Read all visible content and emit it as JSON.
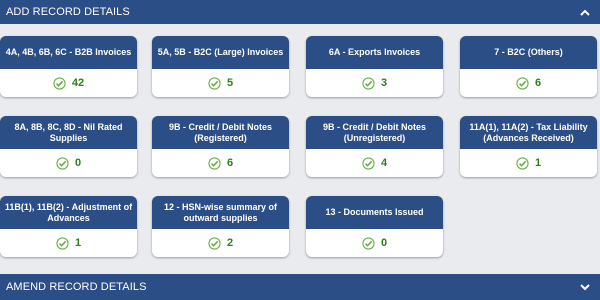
{
  "add_section": {
    "title": "ADD RECORD DETAILS",
    "icon": "chevron-up-icon"
  },
  "amend_section": {
    "title": "AMEND RECORD DETAILS",
    "icon": "chevron-down-icon"
  },
  "colors": {
    "header": "#2c4e86",
    "count": "#2e7d1f",
    "check": "#6ab04c"
  },
  "tiles": [
    {
      "title": "4A, 4B, 6B, 6C - B2B Invoices",
      "count": "42"
    },
    {
      "title": "5A, 5B - B2C (Large) Invoices",
      "count": "5"
    },
    {
      "title": "6A - Exports Invoices",
      "count": "3"
    },
    {
      "title": "7 - B2C (Others)",
      "count": "6"
    },
    {
      "title": "8A, 8B, 8C, 8D - Nil Rated Supplies",
      "count": "0"
    },
    {
      "title": "9B - Credit / Debit Notes (Registered)",
      "count": "6"
    },
    {
      "title": "9B - Credit / Debit Notes (Unregistered)",
      "count": "4"
    },
    {
      "title": "11A(1), 11A(2) - Tax Liability (Advances Received)",
      "count": "1"
    },
    {
      "title": "11B(1), 11B(2) - Adjustment of Advances",
      "count": "1"
    },
    {
      "title": "12 - HSN-wise summary of outward supplies",
      "count": "2"
    },
    {
      "title": "13 - Documents Issued",
      "count": "0"
    }
  ]
}
